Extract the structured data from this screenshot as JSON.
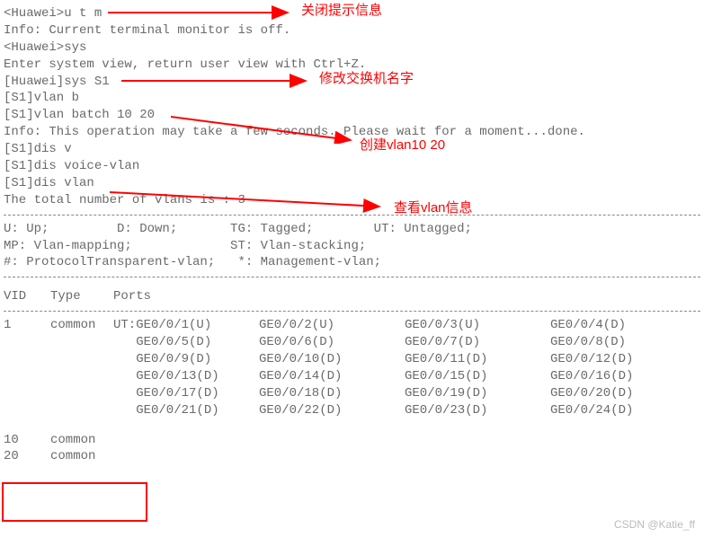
{
  "lines": {
    "l1": "<Huawei>u t m",
    "l2": "Info: Current terminal monitor is off.",
    "l3": "<Huawei>sys",
    "l4": "Enter system view, return user view with Ctrl+Z.",
    "l5": "[Huawei]sys S1",
    "l6": "[S1]vlan b",
    "l7": "[S1]vlan batch 10 20",
    "l8": "Info: This operation may take a few seconds. Please wait for a moment...done.",
    "l9": "[S1]dis v",
    "l10": "[S1]dis voice-vlan",
    "l11": "[S1]dis vlan",
    "l12": "The total number of vlans is : 3",
    "leg1": "U: Up;         D: Down;       TG: Tagged;        UT: Untagged;",
    "leg2": "MP: Vlan-mapping;             ST: Vlan-stacking;",
    "leg3": "#: ProtocolTransparent-vlan;   *: Management-vlan;"
  },
  "header": {
    "vid": "VID",
    "type": "Type",
    "ports": "Ports"
  },
  "vlan1": {
    "vid": "1",
    "type": "common",
    "rows": [
      [
        "UT:GE0/0/1(U)",
        "GE0/0/2(U)",
        "GE0/0/3(U)",
        "GE0/0/4(D)"
      ],
      [
        "   GE0/0/5(D)",
        "GE0/0/6(D)",
        "GE0/0/7(D)",
        "GE0/0/8(D)"
      ],
      [
        "   GE0/0/9(D)",
        "GE0/0/10(D)",
        "GE0/0/11(D)",
        "GE0/0/12(D)"
      ],
      [
        "   GE0/0/13(D)",
        "GE0/0/14(D)",
        "GE0/0/15(D)",
        "GE0/0/16(D)"
      ],
      [
        "   GE0/0/17(D)",
        "GE0/0/18(D)",
        "GE0/0/19(D)",
        "GE0/0/20(D)"
      ],
      [
        "   GE0/0/21(D)",
        "GE0/0/22(D)",
        "GE0/0/23(D)",
        "GE0/0/24(D)"
      ]
    ]
  },
  "extra_vlans": [
    {
      "vid": "10",
      "type": "common"
    },
    {
      "vid": "20",
      "type": "common"
    }
  ],
  "annotations": {
    "a1": "关闭提示信息",
    "a2": "修改交换机名字",
    "a3": "创建vlan10 20",
    "a4": "查看vlan信息"
  },
  "watermark": "CSDN @Katie_ff"
}
